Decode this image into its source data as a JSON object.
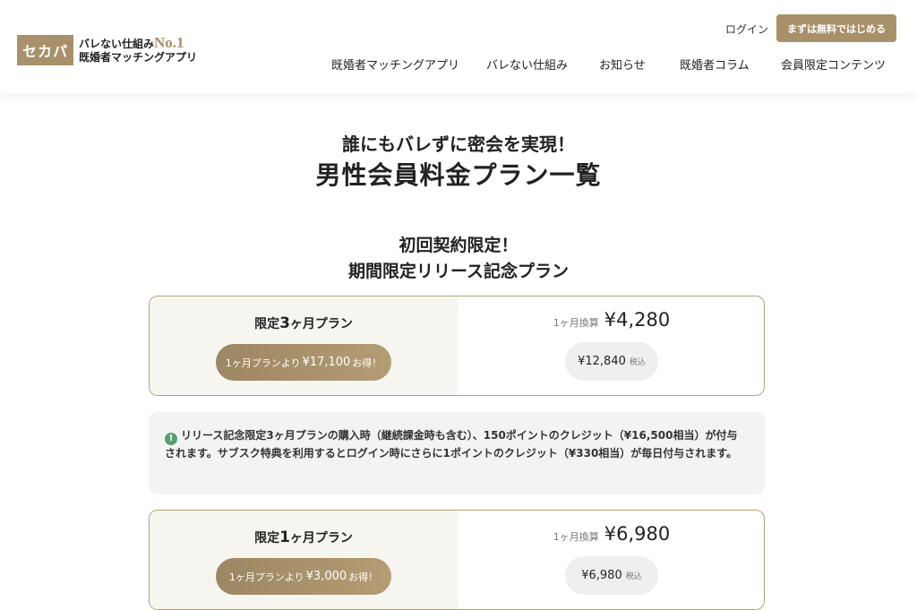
{
  "header": {
    "logo_box": "セカパ",
    "logo_line1": "バレない仕組み",
    "logo_no1": "No.1",
    "logo_line2": "既婚者マッチングアプリ",
    "login_label": "ログイン",
    "cta_label": "まずは無料ではじめる",
    "nav": [
      "既婚者マッチングアプリ",
      "バレない仕組み",
      "お知らせ",
      "既婚者コラム",
      "会員限定コンテンツ"
    ]
  },
  "main": {
    "title_sub": "誰にもバレずに密会を実現！",
    "title_main": "男性会員料金プラン一覧",
    "section_heading_1": "初回契約限定！",
    "section_heading_2": "期間限定リリース記念プラン",
    "plans": [
      {
        "name_prefix": "限定",
        "name_num": "3",
        "name_suffix": "ヶ月プラン",
        "save_prefix": "1ヶ月プランより",
        "save_amount": "¥17,100",
        "save_suffix": "お得！",
        "per_month_label": "1ヶ月換算",
        "per_month_price": "¥4,280",
        "total_price": "¥12,840",
        "tax_label": "税込"
      },
      {
        "name_prefix": "限定",
        "name_num": "1",
        "name_suffix": "ヶ月プラン",
        "save_prefix": "1ヶ月プランより",
        "save_amount": "¥3,000",
        "save_suffix": "お得！",
        "per_month_label": "1ヶ月換算",
        "per_month_price": "¥6,980",
        "total_price": "¥6,980",
        "tax_label": "税込"
      }
    ],
    "notice": {
      "icon": "!",
      "text": "リリース記念限定3ヶ月プランの購入時（継続課金時も含む）、150ポイントのクレジット（¥16,500相当）が付与されます。サブスク特典を利用するとログイン時にさらに1ポイントのクレジット（¥330相当）が毎日付与されます。"
    }
  },
  "colors": {
    "accent": "#a8916a",
    "plan_left_bg": "#f7f5f0",
    "notice_bg": "#f3f3f3",
    "notice_icon": "#5a9e6f"
  }
}
